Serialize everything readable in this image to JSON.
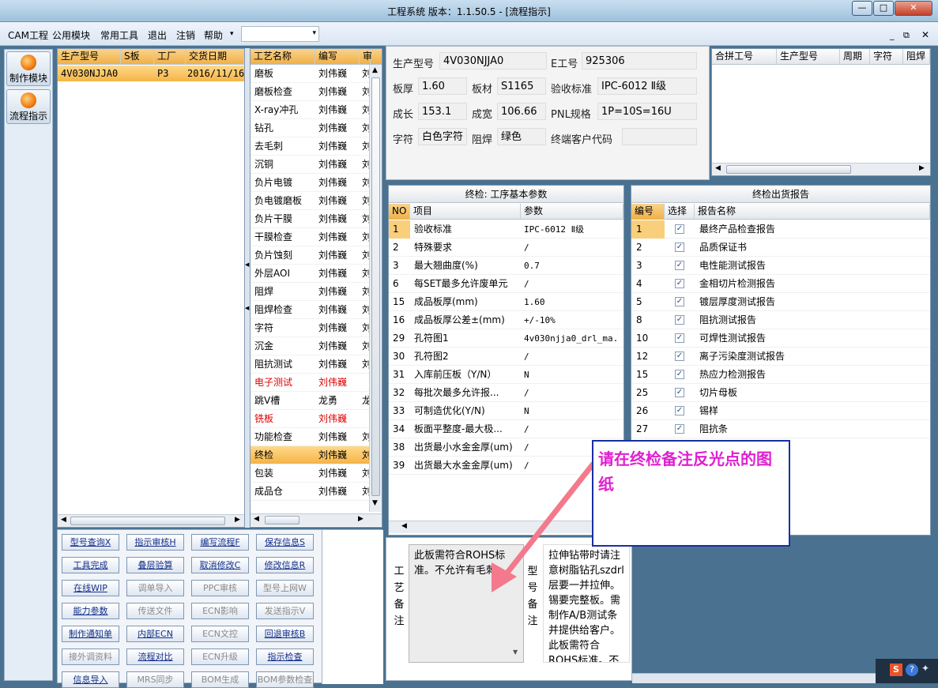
{
  "window": {
    "title": "工程系统  版本：1.1.50.5 - [流程指示]"
  },
  "menu": {
    "items": [
      "CAM工程",
      "公用模块",
      "常用工具",
      "退出",
      "注销",
      "帮助"
    ]
  },
  "leftnav": {
    "items": [
      "制作模块",
      "流程指示"
    ]
  },
  "orders": {
    "columns": [
      "生产型号",
      "S板",
      "工厂",
      "交货日期"
    ],
    "rows": [
      [
        "4V030NJJA0",
        "",
        "P3",
        "2016/11/16"
      ]
    ]
  },
  "process": {
    "columns": [
      "工艺名称",
      "编写",
      "审"
    ],
    "rows": [
      {
        "name": "磨板",
        "writer": "刘伟巍",
        "c": "刘"
      },
      {
        "name": "磨板检查",
        "writer": "刘伟巍",
        "c": "刘"
      },
      {
        "name": "X-ray冲孔",
        "writer": "刘伟巍",
        "c": "刘"
      },
      {
        "name": "钻孔",
        "writer": "刘伟巍",
        "c": "刘"
      },
      {
        "name": "去毛刺",
        "writer": "刘伟巍",
        "c": "刘"
      },
      {
        "name": "沉铜",
        "writer": "刘伟巍",
        "c": "刘"
      },
      {
        "name": "负片电镀",
        "writer": "刘伟巍",
        "c": "刘"
      },
      {
        "name": "负电镀磨板",
        "writer": "刘伟巍",
        "c": "刘"
      },
      {
        "name": "负片干膜",
        "writer": "刘伟巍",
        "c": "刘"
      },
      {
        "name": "干膜检查",
        "writer": "刘伟巍",
        "c": "刘"
      },
      {
        "name": "负片蚀刻",
        "writer": "刘伟巍",
        "c": "刘"
      },
      {
        "name": "外层AOI",
        "writer": "刘伟巍",
        "c": "刘"
      },
      {
        "name": "阻焊",
        "writer": "刘伟巍",
        "c": "刘"
      },
      {
        "name": "阻焊检查",
        "writer": "刘伟巍",
        "c": "刘"
      },
      {
        "name": "字符",
        "writer": "刘伟巍",
        "c": "刘"
      },
      {
        "name": "沉金",
        "writer": "刘伟巍",
        "c": "刘"
      },
      {
        "name": "阻抗测试",
        "writer": "刘伟巍",
        "c": "刘"
      },
      {
        "name": "电子测试",
        "writer": "刘伟巍",
        "c": ""
      },
      {
        "name": "跳V槽",
        "writer": "龙勇",
        "c": "龙"
      },
      {
        "name": "铣板",
        "writer": "刘伟巍",
        "c": ""
      },
      {
        "name": "功能检查",
        "writer": "刘伟巍",
        "c": "刘"
      },
      {
        "name": "终检",
        "writer": "刘伟巍",
        "c": "刘"
      },
      {
        "name": "包装",
        "writer": "刘伟巍",
        "c": "刘"
      },
      {
        "name": "成品仓",
        "writer": "刘伟巍",
        "c": "刘"
      }
    ]
  },
  "actions": [
    [
      "型号查询X",
      "指示审核H",
      "编写流程F",
      "保存信息S"
    ],
    [
      "工具完成",
      "叠层验算",
      "取消修改C",
      "修改信息R"
    ],
    [
      "在线WIP",
      "调单导入",
      "PPC审核",
      "型号上网W"
    ],
    [
      "能力参数",
      "传送文件",
      "ECN影响",
      "发送指示V"
    ],
    [
      "制作通知单",
      "内部ECN",
      "ECN文控",
      "回退审核B"
    ],
    [
      "接外调资料",
      "流程对比",
      "ECN升级",
      "指示检查"
    ],
    [
      "信息导入",
      "MRS同步",
      "BOM生成",
      "BOM参数检查"
    ]
  ],
  "form": {
    "model_label": "生产型号",
    "model": "4V030NJJA0",
    "eno_label": "E工号",
    "eno": "925306",
    "thick_label": "板厚",
    "thick": "1.60",
    "material_label": "板材",
    "material": "S1165",
    "std_label": "验收标准",
    "std": "IPC-6012 Ⅱ级",
    "len_label": "成长",
    "len": "153.1",
    "width_label": "成宽",
    "width": "106.66",
    "pnl_label": "PNL规格",
    "pnl": "1P=10S=16U",
    "char_label": "字符",
    "char": "白色字符",
    "mask_label": "阻焊",
    "mask": "绿色",
    "cust_label": "终端客户代码",
    "cust": ""
  },
  "merge": {
    "columns": [
      "合拼工号",
      "生产型号",
      "周期",
      "字符",
      "阻焊"
    ]
  },
  "params": {
    "title": "终检: 工序基本参数",
    "columns": [
      "NO",
      "项目",
      "参数"
    ],
    "rows": [
      [
        "1",
        "验收标准",
        "IPC-6012 Ⅱ级"
      ],
      [
        "2",
        "特殊要求",
        "/"
      ],
      [
        "3",
        "最大翘曲度(%)",
        "0.7"
      ],
      [
        "6",
        "每SET最多允许废单元",
        "/"
      ],
      [
        "15",
        "成品板厚(mm)",
        "1.60"
      ],
      [
        "16",
        "成品板厚公差±(mm)",
        "+/-10%"
      ],
      [
        "29",
        "孔符图1",
        "4v030njja0_drl_ma."
      ],
      [
        "30",
        "孔符图2",
        "/"
      ],
      [
        "31",
        "入库前压板（Y/N）",
        "N"
      ],
      [
        "32",
        "每批次最多允许报...",
        "/"
      ],
      [
        "33",
        "可制造优化(Y/N)",
        "N"
      ],
      [
        "34",
        "板面平整度-最大极...",
        "/"
      ],
      [
        "38",
        "出货最小水金金厚(um)",
        "/"
      ],
      [
        "39",
        "出货最大水金金厚(um)",
        "/"
      ]
    ]
  },
  "reports": {
    "title": "终检出货报告",
    "columns": [
      "编号",
      "选择",
      "报告名称"
    ],
    "rows": [
      [
        "1",
        "最终产品检查报告"
      ],
      [
        "2",
        "品质保证书"
      ],
      [
        "3",
        "电性能测试报告"
      ],
      [
        "4",
        "金相切片检测报告"
      ],
      [
        "5",
        "镀层厚度测试报告"
      ],
      [
        "8",
        "阻抗测试报告"
      ],
      [
        "10",
        "可焊性测试报告"
      ],
      [
        "12",
        "离子污染度测试报告"
      ],
      [
        "15",
        "热应力检测报告"
      ],
      [
        "25",
        "切片母板"
      ],
      [
        "26",
        "锡样"
      ],
      [
        "27",
        "阻抗条"
      ]
    ]
  },
  "notes": {
    "craft_label": [
      "工",
      "艺",
      "备",
      "注"
    ],
    "craft_text": "此板需符合ROHS标准。不允许有毛刺。",
    "model_label": [
      "型",
      "号",
      "备",
      "注"
    ],
    "model_text": "拉伸钻带时请注意树脂钻孔szdrl层要一并拉伸。锡要完整板。需制作A/B测试条并提供给客户。此板需符合ROHS标准。不允"
  },
  "callout": {
    "text": "请在终检备注反光点的图纸"
  },
  "colors": {
    "selected_row": "#f4b447",
    "callout_text": "#e020d0",
    "arrow": "#f27a8c",
    "link_text": "#15308a"
  }
}
